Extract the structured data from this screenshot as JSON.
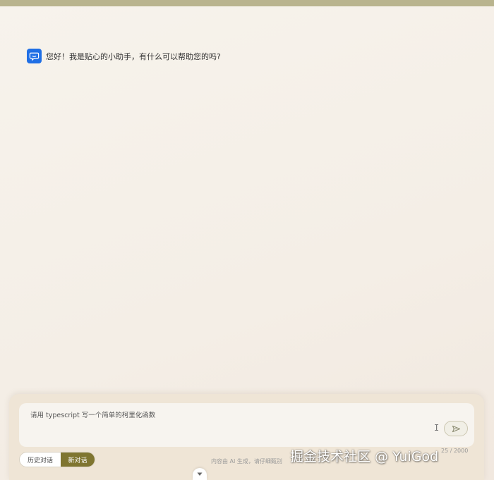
{
  "chat": {
    "greeting": "您好！我是贴心的小助手，有什么可以帮助您的吗?"
  },
  "composer": {
    "input_value": "请用 typescript 写一个简单的柯里化函数",
    "char_count": "25 / 2000",
    "history_label": "历史对话",
    "new_chat_label": "新对话",
    "disclaimer": "内容由 AI 生成，请仔细甄别"
  },
  "watermark": "掘金技术社区 @ YuiGod",
  "colors": {
    "accent": "#7f7530",
    "avatar": "#1f6fe5",
    "top_bar": "#b9b48e"
  },
  "icons": {
    "avatar": "chat-bubble-icon",
    "send": "send-icon",
    "caret": "text-cursor-icon",
    "scroll": "chevron-down-icon"
  }
}
